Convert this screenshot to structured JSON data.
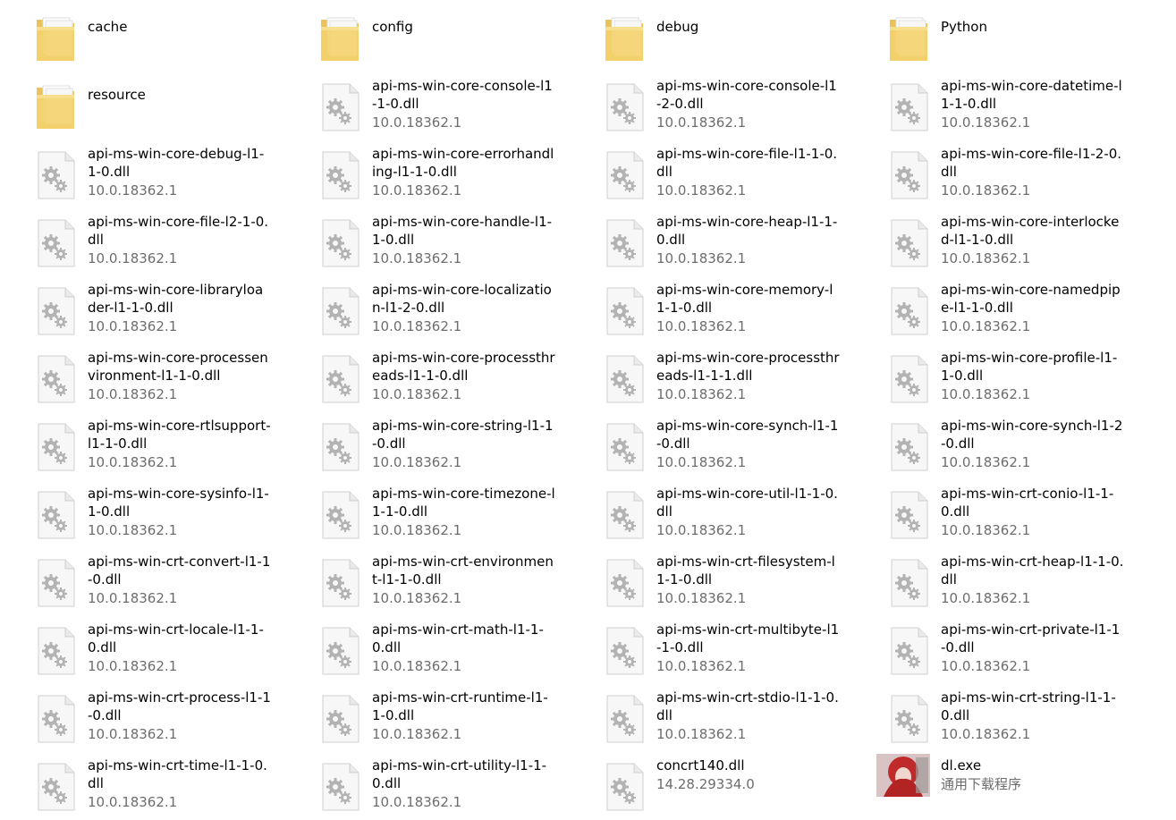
{
  "files": [
    {
      "name": "cache",
      "type": "folder",
      "icon": "folder-icon"
    },
    {
      "name": "config",
      "type": "folder",
      "icon": "folder-icon"
    },
    {
      "name": "debug",
      "type": "folder",
      "icon": "folder-icon"
    },
    {
      "name": "Python",
      "type": "folder",
      "icon": "folder-icon"
    },
    {
      "name": "resource",
      "type": "folder",
      "icon": "folder-icon"
    },
    {
      "name": "api-ms-win-core-console-l1-1-0.dll",
      "sub": "10.0.18362.1",
      "type": "dll",
      "icon": "dll-file-icon"
    },
    {
      "name": "api-ms-win-core-console-l1-2-0.dll",
      "sub": "10.0.18362.1",
      "type": "dll",
      "icon": "dll-file-icon"
    },
    {
      "name": "api-ms-win-core-datetime-l1-1-0.dll",
      "sub": "10.0.18362.1",
      "type": "dll",
      "icon": "dll-file-icon"
    },
    {
      "name": "api-ms-win-core-debug-l1-1-0.dll",
      "sub": "10.0.18362.1",
      "type": "dll",
      "icon": "dll-file-icon"
    },
    {
      "name": "api-ms-win-core-errorhandling-l1-1-0.dll",
      "sub": "10.0.18362.1",
      "type": "dll",
      "icon": "dll-file-icon"
    },
    {
      "name": "api-ms-win-core-file-l1-1-0.dll",
      "sub": "10.0.18362.1",
      "type": "dll",
      "icon": "dll-file-icon"
    },
    {
      "name": "api-ms-win-core-file-l1-2-0.dll",
      "sub": "10.0.18362.1",
      "type": "dll",
      "icon": "dll-file-icon"
    },
    {
      "name": "api-ms-win-core-file-l2-1-0.dll",
      "sub": "10.0.18362.1",
      "type": "dll",
      "icon": "dll-file-icon"
    },
    {
      "name": "api-ms-win-core-handle-l1-1-0.dll",
      "sub": "10.0.18362.1",
      "type": "dll",
      "icon": "dll-file-icon"
    },
    {
      "name": "api-ms-win-core-heap-l1-1-0.dll",
      "sub": "10.0.18362.1",
      "type": "dll",
      "icon": "dll-file-icon"
    },
    {
      "name": "api-ms-win-core-interlocked-l1-1-0.dll",
      "sub": "10.0.18362.1",
      "type": "dll",
      "icon": "dll-file-icon"
    },
    {
      "name": "api-ms-win-core-libraryloader-l1-1-0.dll",
      "sub": "10.0.18362.1",
      "type": "dll",
      "icon": "dll-file-icon"
    },
    {
      "name": "api-ms-win-core-localization-l1-2-0.dll",
      "sub": "10.0.18362.1",
      "type": "dll",
      "icon": "dll-file-icon"
    },
    {
      "name": "api-ms-win-core-memory-l1-1-0.dll",
      "sub": "10.0.18362.1",
      "type": "dll",
      "icon": "dll-file-icon"
    },
    {
      "name": "api-ms-win-core-namedpipe-l1-1-0.dll",
      "sub": "10.0.18362.1",
      "type": "dll",
      "icon": "dll-file-icon"
    },
    {
      "name": "api-ms-win-core-processenvironment-l1-1-0.dll",
      "sub": "10.0.18362.1",
      "type": "dll",
      "icon": "dll-file-icon"
    },
    {
      "name": "api-ms-win-core-processthreads-l1-1-0.dll",
      "sub": "10.0.18362.1",
      "type": "dll",
      "icon": "dll-file-icon"
    },
    {
      "name": "api-ms-win-core-processthreads-l1-1-1.dll",
      "sub": "10.0.18362.1",
      "type": "dll",
      "icon": "dll-file-icon"
    },
    {
      "name": "api-ms-win-core-profile-l1-1-0.dll",
      "sub": "10.0.18362.1",
      "type": "dll",
      "icon": "dll-file-icon"
    },
    {
      "name": "api-ms-win-core-rtlsupport-l1-1-0.dll",
      "sub": "10.0.18362.1",
      "type": "dll",
      "icon": "dll-file-icon"
    },
    {
      "name": "api-ms-win-core-string-l1-1-0.dll",
      "sub": "10.0.18362.1",
      "type": "dll",
      "icon": "dll-file-icon"
    },
    {
      "name": "api-ms-win-core-synch-l1-1-0.dll",
      "sub": "10.0.18362.1",
      "type": "dll",
      "icon": "dll-file-icon"
    },
    {
      "name": "api-ms-win-core-synch-l1-2-0.dll",
      "sub": "10.0.18362.1",
      "type": "dll",
      "icon": "dll-file-icon"
    },
    {
      "name": "api-ms-win-core-sysinfo-l1-1-0.dll",
      "sub": "10.0.18362.1",
      "type": "dll",
      "icon": "dll-file-icon"
    },
    {
      "name": "api-ms-win-core-timezone-l1-1-0.dll",
      "sub": "10.0.18362.1",
      "type": "dll",
      "icon": "dll-file-icon"
    },
    {
      "name": "api-ms-win-core-util-l1-1-0.dll",
      "sub": "10.0.18362.1",
      "type": "dll",
      "icon": "dll-file-icon"
    },
    {
      "name": "api-ms-win-crt-conio-l1-1-0.dll",
      "sub": "10.0.18362.1",
      "type": "dll",
      "icon": "dll-file-icon"
    },
    {
      "name": "api-ms-win-crt-convert-l1-1-0.dll",
      "sub": "10.0.18362.1",
      "type": "dll",
      "icon": "dll-file-icon"
    },
    {
      "name": "api-ms-win-crt-environment-l1-1-0.dll",
      "sub": "10.0.18362.1",
      "type": "dll",
      "icon": "dll-file-icon"
    },
    {
      "name": "api-ms-win-crt-filesystem-l1-1-0.dll",
      "sub": "10.0.18362.1",
      "type": "dll",
      "icon": "dll-file-icon"
    },
    {
      "name": "api-ms-win-crt-heap-l1-1-0.dll",
      "sub": "10.0.18362.1",
      "type": "dll",
      "icon": "dll-file-icon"
    },
    {
      "name": "api-ms-win-crt-locale-l1-1-0.dll",
      "sub": "10.0.18362.1",
      "type": "dll",
      "icon": "dll-file-icon"
    },
    {
      "name": "api-ms-win-crt-math-l1-1-0.dll",
      "sub": "10.0.18362.1",
      "type": "dll",
      "icon": "dll-file-icon"
    },
    {
      "name": "api-ms-win-crt-multibyte-l1-1-0.dll",
      "sub": "10.0.18362.1",
      "type": "dll",
      "icon": "dll-file-icon"
    },
    {
      "name": "api-ms-win-crt-private-l1-1-0.dll",
      "sub": "10.0.18362.1",
      "type": "dll",
      "icon": "dll-file-icon"
    },
    {
      "name": "api-ms-win-crt-process-l1-1-0.dll",
      "sub": "10.0.18362.1",
      "type": "dll",
      "icon": "dll-file-icon"
    },
    {
      "name": "api-ms-win-crt-runtime-l1-1-0.dll",
      "sub": "10.0.18362.1",
      "type": "dll",
      "icon": "dll-file-icon"
    },
    {
      "name": "api-ms-win-crt-stdio-l1-1-0.dll",
      "sub": "10.0.18362.1",
      "type": "dll",
      "icon": "dll-file-icon"
    },
    {
      "name": "api-ms-win-crt-string-l1-1-0.dll",
      "sub": "10.0.18362.1",
      "type": "dll",
      "icon": "dll-file-icon"
    },
    {
      "name": "api-ms-win-crt-time-l1-1-0.dll",
      "sub": "10.0.18362.1",
      "type": "dll",
      "icon": "dll-file-icon"
    },
    {
      "name": "api-ms-win-crt-utility-l1-1-0.dll",
      "sub": "10.0.18362.1",
      "type": "dll",
      "icon": "dll-file-icon"
    },
    {
      "name": "concrt140.dll",
      "sub": "14.28.29334.0",
      "type": "dll",
      "icon": "dll-file-icon"
    },
    {
      "name": "dl.exe",
      "sub": "通用下载程序",
      "type": "exe",
      "icon": "app-icon"
    }
  ]
}
